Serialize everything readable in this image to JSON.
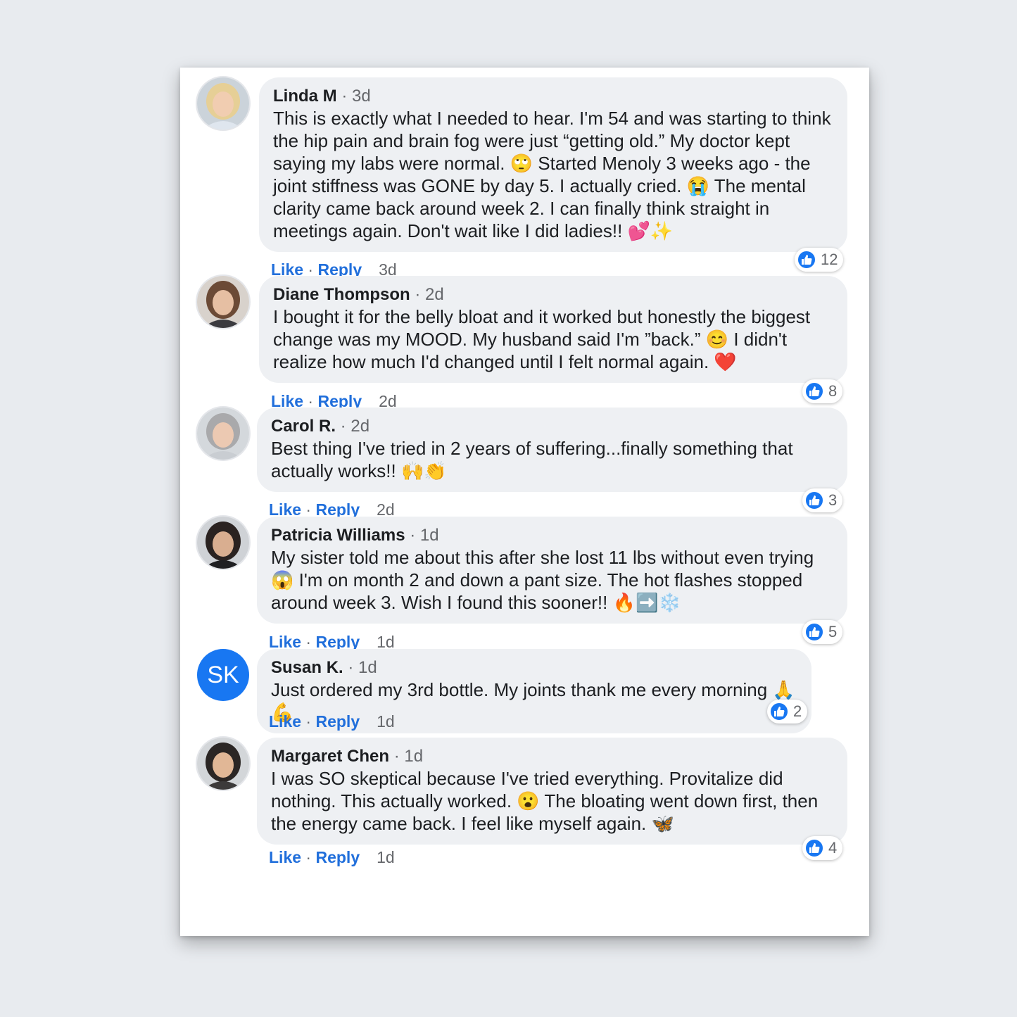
{
  "comments": [
    {
      "author": "Linda M",
      "time": "3d",
      "text": "This is exactly what I needed to hear. I'm 54 and was starting to think the hip pain and brain fog were just “getting old.” My doctor kept saying my labs were normal. 🙄 Started Menoly 3 weeks ago - the joint stiffness was GONE by day 5. I actually cried. 😭 The mental clarity came back around week 2. I can finally think straight in meetings again. Don't wait like I did ladies!! 💕✨",
      "likes": "12",
      "actions": {
        "like": "Like",
        "reply": "Reply",
        "time": "3d"
      }
    },
    {
      "author": "Diane Thompson",
      "time": "2d",
      "text": "I bought it for the belly bloat and it worked but honestly the biggest change was my MOOD. My husband said I'm ”back.” 😊 I didn't realize how much I'd changed until I felt normal again. ❤️",
      "likes": "8",
      "actions": {
        "like": "Like",
        "reply": "Reply",
        "time": "2d"
      }
    },
    {
      "author": "Carol R.",
      "time": "2d",
      "text": "Best thing I've tried in 2 years of suffering...finally something that actually works!! 🙌👏",
      "likes": "3",
      "actions": {
        "like": "Like",
        "reply": "Reply",
        "time": "2d"
      }
    },
    {
      "author": "Patricia Williams",
      "time": "1d",
      "text": "My sister told me about this after she lost 11 lbs without even trying 😱 I'm on month 2 and down a pant size. The hot flashes stopped around week 3. Wish I found this sooner!! 🔥➡️❄️",
      "likes": "5",
      "actions": {
        "like": "Like",
        "reply": "Reply",
        "time": "1d"
      }
    },
    {
      "author": "Susan K.",
      "time": "1d",
      "initials": "SK",
      "text": "Just ordered my 3rd bottle. My joints thank me every morning 🙏💪",
      "likes": "2",
      "actions": {
        "like": "Like",
        "reply": "Reply",
        "time": "1d"
      }
    },
    {
      "author": "Margaret Chen",
      "time": "1d",
      "text": "I was SO skeptical because I've tried everything. Provitalize did nothing. This actually worked. 😮 The bloating went down first, then the energy came back. I feel like myself again. 🦋",
      "likes": "4",
      "actions": {
        "like": "Like",
        "reply": "Reply",
        "time": "1d"
      }
    }
  ],
  "colors": {
    "link_blue": "#216fdb",
    "like_blue": "#1877f2",
    "bubble": "#eef0f3",
    "muted": "#65676b"
  },
  "icons": {
    "reaction": "thumbs-up-icon"
  }
}
